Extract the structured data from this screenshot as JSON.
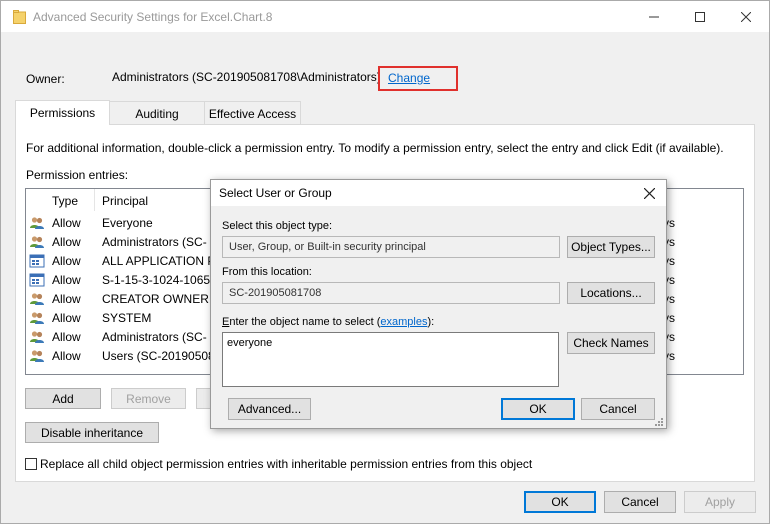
{
  "window": {
    "title": "Advanced Security Settings for Excel.Chart.8",
    "minimize_glyph": "—",
    "maximize_glyph": "☐",
    "close_glyph": "✕"
  },
  "owner": {
    "label": "Owner:",
    "value": "Administrators (SC-201905081708\\Administrators)",
    "change_link": "Change",
    "highlight_color": "#e0302c"
  },
  "tabs": [
    {
      "label": "Permissions",
      "active": true
    },
    {
      "label": "Auditing",
      "active": false
    },
    {
      "label": "Effective Access",
      "active": false
    }
  ],
  "permissions": {
    "info_text": "For additional information, double-click a permission entry. To modify a permission entry, select the entry and click Edit (if available).",
    "entries_label": "Permission entries:",
    "columns": [
      "Type",
      "Principal"
    ],
    "rows": [
      {
        "type": "Allow",
        "principal": "Everyone",
        "icon": "users-icon",
        "access_fragment": "ys"
      },
      {
        "type": "Allow",
        "principal": "Administrators (SC-",
        "icon": "users-icon",
        "access_fragment": "ys"
      },
      {
        "type": "Allow",
        "principal": "ALL APPLICATION PA",
        "icon": "app-package-icon",
        "access_fragment": "ys"
      },
      {
        "type": "Allow",
        "principal": "S-1-15-3-1024-10653",
        "icon": "app-package-icon",
        "access_fragment": "ys"
      },
      {
        "type": "Allow",
        "principal": "CREATOR OWNER",
        "icon": "users-icon",
        "access_fragment": "ys"
      },
      {
        "type": "Allow",
        "principal": "SYSTEM",
        "icon": "users-icon",
        "access_fragment": "ys"
      },
      {
        "type": "Allow",
        "principal": "Administrators (SC-",
        "icon": "users-icon",
        "access_fragment": "ys"
      },
      {
        "type": "Allow",
        "principal": "Users (SC-201905081",
        "icon": "users-icon",
        "access_fragment": "ys"
      }
    ],
    "add_button": "Add",
    "remove_button": "Remove",
    "disable_inheritance_button": "Disable inheritance",
    "replace_checkbox_label": "Replace all child object permission entries with inheritable permission entries from this object",
    "replace_checked": false
  },
  "footer": {
    "ok": "OK",
    "cancel": "Cancel",
    "apply": "Apply"
  },
  "dialog": {
    "title": "Select User or Group",
    "close_glyph": "✕",
    "object_type_label": "Select this object type:",
    "object_type_value": "User, Group, or Built-in security principal",
    "object_types_button": "Object Types...",
    "location_label": "From this location:",
    "location_value": "SC-201905081708",
    "locations_button": "Locations...",
    "enter_name_prefix": "nter the object name to select (",
    "enter_name_accel": "E",
    "examples_link": "examples",
    "enter_name_suffix": "):",
    "name_value": "everyone",
    "check_names_button": "Check Names",
    "advanced_button": "Advanced...",
    "ok_button": "OK",
    "cancel_button": "Cancel"
  }
}
